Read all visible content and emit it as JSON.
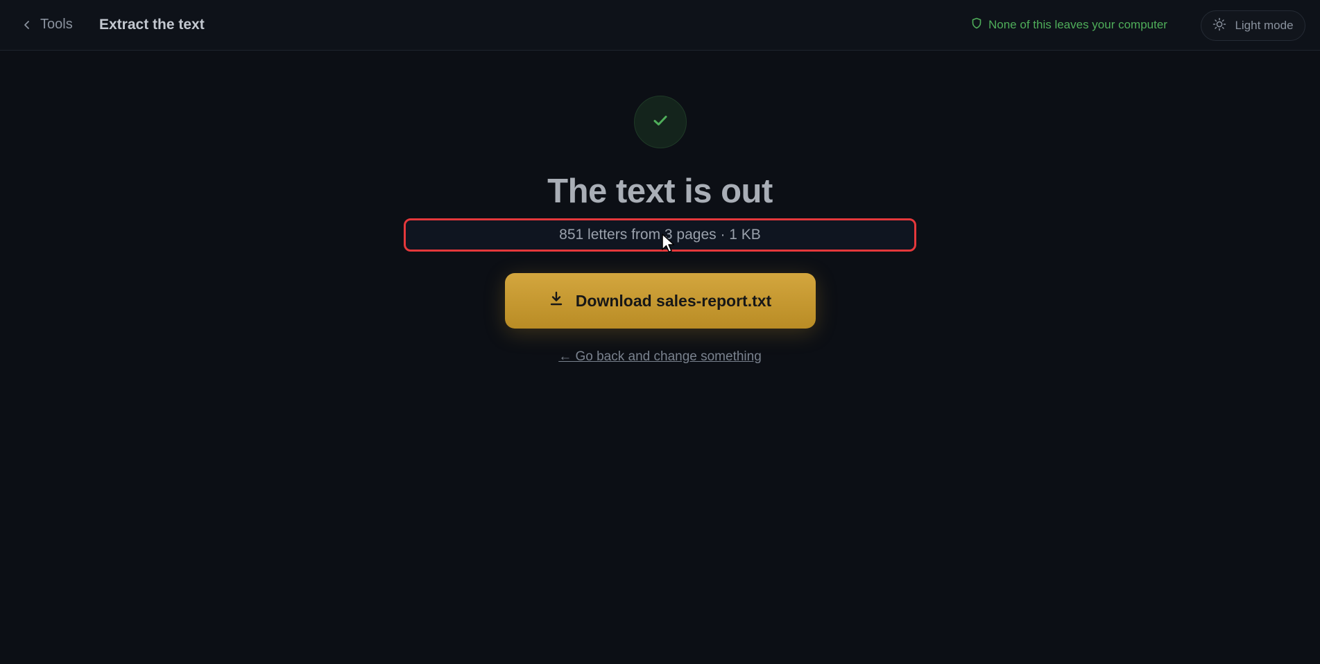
{
  "header": {
    "back_label": "Tools",
    "title": "Extract the text",
    "privacy_text": "None of this leaves your computer",
    "theme_toggle_label": "Light mode"
  },
  "result": {
    "headline": "The text is out",
    "stats": "851 letters from 3 pages · 1 KB",
    "download_label": "Download sales-report.txt",
    "go_back_label": "← Go back and change something"
  },
  "icons": {
    "back": "chevron-left-icon",
    "privacy": "shield-icon",
    "theme": "sun-icon",
    "success": "check-icon",
    "download": "download-icon",
    "cursor": "mouse-cursor"
  },
  "colors": {
    "background": "#0c0f15",
    "accent": "#c99a2e",
    "success": "#4fae5a",
    "highlight_border": "#e5383b"
  }
}
